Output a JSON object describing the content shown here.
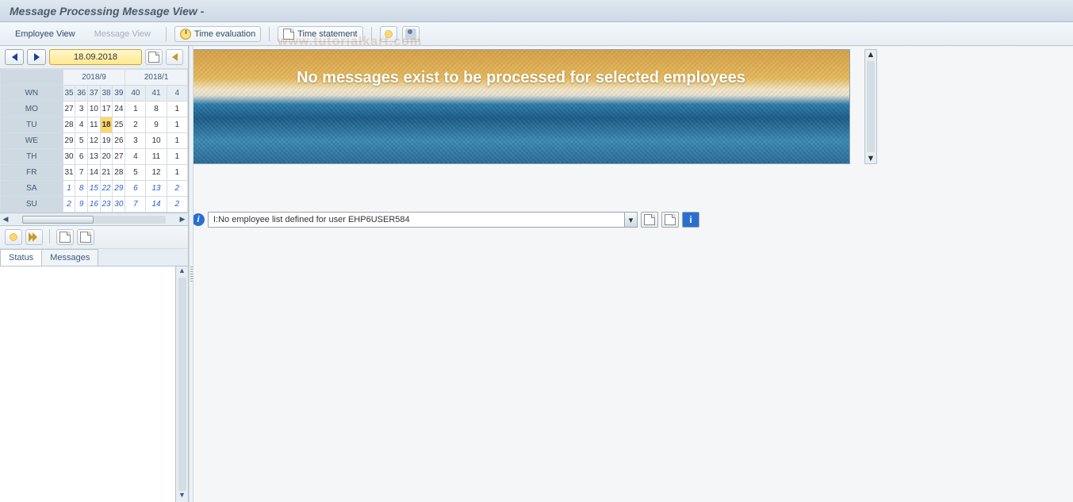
{
  "title": "Message Processing Message View -",
  "menu": {
    "employee_view": "Employee View",
    "message_view": "Message View",
    "time_eval": "Time evaluation",
    "time_stmt": "Time statement"
  },
  "date_nav": {
    "date": "18.09.2018"
  },
  "calendar": {
    "month1": "2018/9",
    "month2": "2018/1",
    "wn_label": "WN",
    "weeks": [
      "35",
      "36",
      "37",
      "38",
      "39",
      "40",
      "41",
      "4"
    ],
    "days": [
      {
        "n": "MO",
        "v": [
          "27",
          "3",
          "10",
          "17",
          "24",
          "1",
          "8",
          "1"
        ]
      },
      {
        "n": "TU",
        "v": [
          "28",
          "4",
          "11",
          "18",
          "25",
          "2",
          "9",
          "1"
        ]
      },
      {
        "n": "WE",
        "v": [
          "29",
          "5",
          "12",
          "19",
          "26",
          "3",
          "10",
          "1"
        ]
      },
      {
        "n": "TH",
        "v": [
          "30",
          "6",
          "13",
          "20",
          "27",
          "4",
          "11",
          "1"
        ]
      },
      {
        "n": "FR",
        "v": [
          "31",
          "7",
          "14",
          "21",
          "28",
          "5",
          "12",
          "1"
        ]
      },
      {
        "n": "SA",
        "v": [
          "1",
          "8",
          "15",
          "22",
          "29",
          "6",
          "13",
          "2"
        ],
        "weekend": true
      },
      {
        "n": "SU",
        "v": [
          "2",
          "9",
          "16",
          "23",
          "30",
          "7",
          "14",
          "2"
        ],
        "weekend": true
      }
    ],
    "today_row": 1,
    "today_col": 3
  },
  "tabs": {
    "status": "Status",
    "messages": "Messages"
  },
  "banner_text": "No messages exist to be processed for selected employees",
  "status_msg": "I:No employee list defined for user EHP6USER584",
  "watermark": "www.tutorialkart.com"
}
